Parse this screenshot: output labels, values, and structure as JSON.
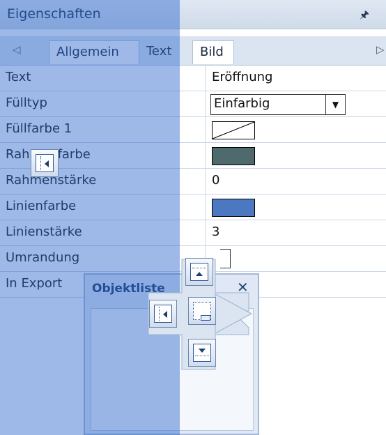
{
  "panel": {
    "title": "Eigenschaften",
    "pin_icon": "pin-icon",
    "close_icon": "close-icon"
  },
  "tabs": [
    {
      "label": "Allgemein",
      "active": true
    },
    {
      "label": "Text",
      "active": false
    },
    {
      "label": "Bild",
      "active": false
    }
  ],
  "properties": [
    {
      "name": "Text",
      "value": "Eröffnung",
      "kind": "text"
    },
    {
      "name": "Fülltyp",
      "value": "Einfarbig",
      "kind": "combo"
    },
    {
      "name": "Füllfarbe 1",
      "value": "",
      "kind": "swatch-none"
    },
    {
      "name": "Rahmenfarbe",
      "value": "#4e6a6c",
      "kind": "swatch"
    },
    {
      "name": "Rahmenstärke",
      "value": "0",
      "kind": "text"
    },
    {
      "name": "Linienfarbe",
      "value": "#4b78c0",
      "kind": "swatch"
    },
    {
      "name": "Linienstärke",
      "value": "3",
      "kind": "text"
    },
    {
      "name": "Umrandung",
      "value": "",
      "kind": "checkbox"
    },
    {
      "name": "In Export",
      "value": "",
      "kind": "text"
    }
  ],
  "objektliste": {
    "title": "Objektliste",
    "close_icon": "close-icon"
  },
  "colors": {
    "overlay": "#2864cd",
    "accent": "#1e3d6b"
  }
}
